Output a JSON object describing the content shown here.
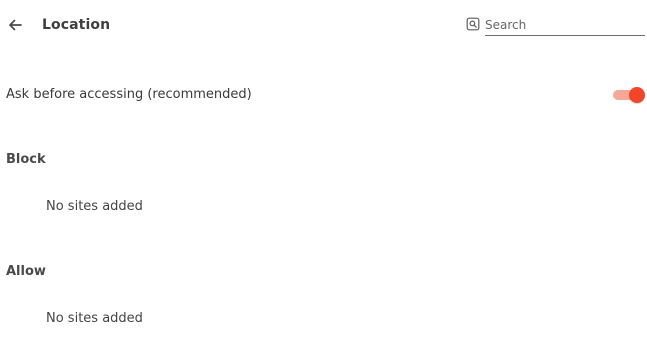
{
  "header": {
    "title": "Location",
    "back_icon": "arrow-left-icon",
    "search": {
      "placeholder": "Search",
      "value": "",
      "icon": "search-icon"
    }
  },
  "setting": {
    "label": "Ask before accessing (recommended)",
    "enabled": true,
    "accent_color": "#f1462a"
  },
  "sections": [
    {
      "heading": "Block",
      "empty_text": "No sites added"
    },
    {
      "heading": "Allow",
      "empty_text": "No sites added"
    }
  ]
}
